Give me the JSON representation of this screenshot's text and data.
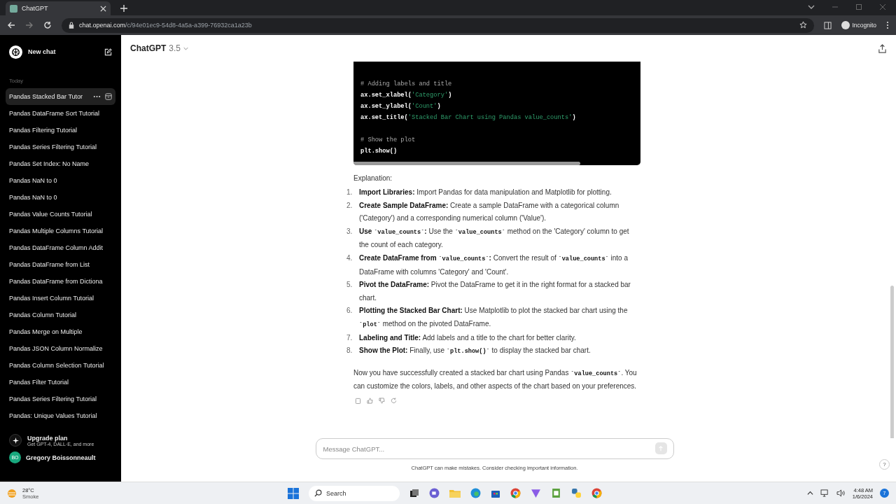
{
  "browser": {
    "tab_title": "ChatGPT",
    "url_host": "chat.openai.com",
    "url_path": "/c/94e01ec9-54d8-4a5a-a399-76932ca1a23b",
    "profile": "Incognito"
  },
  "sidebar": {
    "new_chat": "New chat",
    "section": "Today",
    "items": [
      {
        "title": "Pandas Stacked Bar Tutor",
        "selected": true
      },
      {
        "title": "Pandas DataFrame Sort Tutorial",
        "selected": false
      },
      {
        "title": "Pandas Filtering Tutorial",
        "selected": false
      },
      {
        "title": "Pandas Series Filtering Tutorial",
        "selected": false
      },
      {
        "title": "Pandas Set Index: No Name",
        "selected": false
      },
      {
        "title": "Pandas NaN to 0",
        "selected": false
      },
      {
        "title": "Pandas NaN to 0",
        "selected": false
      },
      {
        "title": "Pandas Value Counts Tutorial",
        "selected": false
      },
      {
        "title": "Pandas Multiple Columns Tutorial",
        "selected": false
      },
      {
        "title": "Pandas DataFrame Column Addit",
        "selected": false
      },
      {
        "title": "Pandas DataFrame from List",
        "selected": false
      },
      {
        "title": "Pandas DataFrame from Dictiona",
        "selected": false
      },
      {
        "title": "Pandas Insert Column Tutorial",
        "selected": false
      },
      {
        "title": "Pandas Column Tutorial",
        "selected": false
      },
      {
        "title": "Pandas Merge on Multiple",
        "selected": false
      },
      {
        "title": "Pandas JSON Column Normalize",
        "selected": false
      },
      {
        "title": "Pandas Column Selection Tutorial",
        "selected": false
      },
      {
        "title": "Pandas Filter Tutorial",
        "selected": false
      },
      {
        "title": "Pandas Series Filtering Tutorial",
        "selected": false
      },
      {
        "title": "Pandas: Unique Values Tutorial",
        "selected": false
      }
    ],
    "upgrade": {
      "title": "Upgrade plan",
      "subtitle": "Get GPT-4, DALL·E, and more"
    },
    "user": {
      "initials": "BO",
      "name": "Gregory Boissonneault"
    }
  },
  "header": {
    "model": "ChatGPT",
    "version": "3.5"
  },
  "code_lines": [
    {
      "kind": "blank"
    },
    {
      "kind": "comment",
      "parts": [
        {
          "kind": "plain",
          "text": "# Adding labels and title"
        }
      ]
    },
    {
      "kind": "code",
      "parts": [
        {
          "kind": "plain",
          "text": "ax.set_xlabel("
        },
        {
          "kind": "string",
          "text": "'Category'"
        },
        {
          "kind": "plain",
          "text": ")"
        }
      ]
    },
    {
      "kind": "code",
      "parts": [
        {
          "kind": "plain",
          "text": "ax.set_ylabel("
        },
        {
          "kind": "string",
          "text": "'Count'"
        },
        {
          "kind": "plain",
          "text": ")"
        }
      ]
    },
    {
      "kind": "code",
      "parts": [
        {
          "kind": "plain",
          "text": "ax.set_title("
        },
        {
          "kind": "string",
          "text": "'Stacked Bar Chart using Pandas value_counts'"
        },
        {
          "kind": "plain",
          "text": ")"
        }
      ]
    },
    {
      "kind": "blank"
    },
    {
      "kind": "comment",
      "parts": [
        {
          "kind": "plain",
          "text": "# Show the plot"
        }
      ]
    },
    {
      "kind": "code",
      "parts": [
        {
          "kind": "plain",
          "text": "plt.show()"
        }
      ]
    }
  ],
  "explanation_heading": "Explanation:",
  "steps": [
    {
      "number": "1.",
      "parts": [
        {
          "kind": "bold",
          "text": "Import Libraries:"
        },
        {
          "kind": "text",
          "text": " Import Pandas for data manipulation and Matplotlib for plotting."
        }
      ]
    },
    {
      "number": "2.",
      "parts": [
        {
          "kind": "bold",
          "text": "Create Sample DataFrame:"
        },
        {
          "kind": "text",
          "text": " Create a sample DataFrame with a categorical column ('Category') and a corresponding numerical column ('Value')."
        }
      ]
    },
    {
      "number": "3.",
      "parts": [
        {
          "kind": "bold",
          "text": "Use "
        },
        {
          "kind": "code",
          "text": "`value_counts`"
        },
        {
          "kind": "bold",
          "text": ":"
        },
        {
          "kind": "text",
          "text": " Use the "
        },
        {
          "kind": "code",
          "text": "`value_counts`"
        },
        {
          "kind": "text",
          "text": " method on the 'Category' column to get the count of each category."
        }
      ]
    },
    {
      "number": "4.",
      "parts": [
        {
          "kind": "bold",
          "text": "Create DataFrame from "
        },
        {
          "kind": "code",
          "text": "`value_counts`"
        },
        {
          "kind": "bold",
          "text": ":"
        },
        {
          "kind": "text",
          "text": " Convert the result of "
        },
        {
          "kind": "code",
          "text": "`value_counts`"
        },
        {
          "kind": "text",
          "text": " into a DataFrame with columns 'Category' and 'Count'."
        }
      ]
    },
    {
      "number": "5.",
      "parts": [
        {
          "kind": "bold",
          "text": "Pivot the DataFrame:"
        },
        {
          "kind": "text",
          "text": " Pivot the DataFrame to get it in the right format for a stacked bar chart."
        }
      ]
    },
    {
      "number": "6.",
      "parts": [
        {
          "kind": "bold",
          "text": "Plotting the Stacked Bar Chart:"
        },
        {
          "kind": "text",
          "text": " Use Matplotlib to plot the stacked bar chart using the "
        },
        {
          "kind": "code",
          "text": "`plot`"
        },
        {
          "kind": "text",
          "text": " method on the pivoted DataFrame."
        }
      ]
    },
    {
      "number": "7.",
      "parts": [
        {
          "kind": "bold",
          "text": "Labeling and Title:"
        },
        {
          "kind": "text",
          "text": " Add labels and a title to the chart for better clarity."
        }
      ]
    },
    {
      "number": "8.",
      "parts": [
        {
          "kind": "bold",
          "text": "Show the Plot:"
        },
        {
          "kind": "text",
          "text": " Finally, use "
        },
        {
          "kind": "code",
          "text": "`plt.show()`"
        },
        {
          "kind": "text",
          "text": " to display the stacked bar chart."
        }
      ]
    }
  ],
  "closing": [
    {
      "kind": "text",
      "text": "Now you have successfully created a stacked bar chart using Pandas "
    },
    {
      "kind": "code",
      "text": "`value_counts`"
    },
    {
      "kind": "text",
      "text": ". You can customize the colors, labels, and other aspects of the chart based on your preferences."
    }
  ],
  "composer": {
    "placeholder": "Message ChatGPT..."
  },
  "disclaimer": "ChatGPT can make mistakes. Consider checking important information.",
  "help": "?",
  "taskbar": {
    "weather_temp": "28°C",
    "weather_text": "Smoke",
    "search": "Search",
    "time": "4:48 AM",
    "date": "1/6/2024",
    "badge": "7"
  }
}
